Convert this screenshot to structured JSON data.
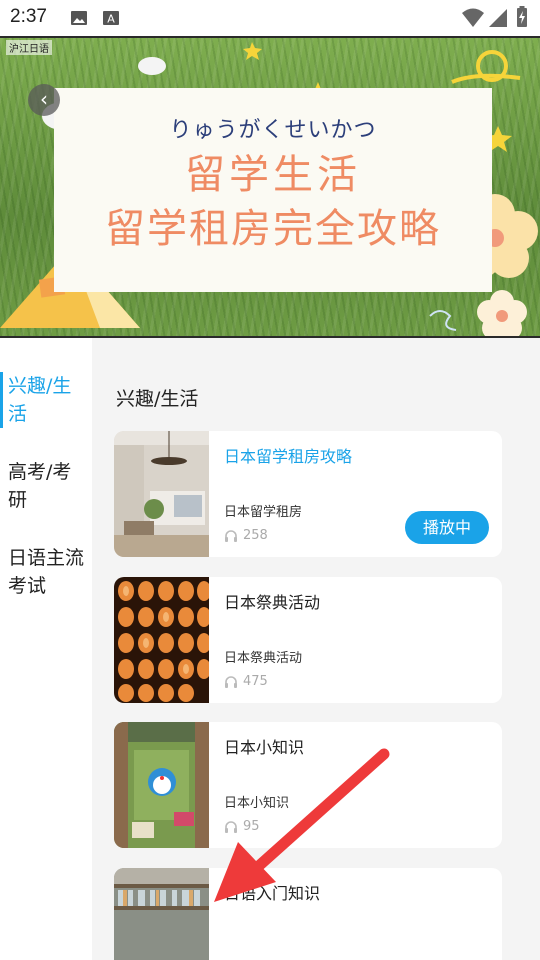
{
  "status_bar": {
    "time": "2:37",
    "icons": [
      "image-icon",
      "font-download-icon",
      "wifi-icon",
      "signal-icon",
      "battery-charging-icon"
    ]
  },
  "banner": {
    "logo_text": "沪江日语",
    "kana": "りゅうがくせいかつ",
    "title_line1": "留学生活",
    "title_line2": "留学租房完全攻略",
    "accent_color": "#ef8b63"
  },
  "sidebar": {
    "items": [
      {
        "label": "兴趣/生活",
        "active": true
      },
      {
        "label": "高考/考研",
        "active": false
      },
      {
        "label": "日语主流考试",
        "active": false
      }
    ]
  },
  "main": {
    "section_title": "兴趣/生活",
    "play_label": "播放中",
    "items": [
      {
        "title": "日本留学租房攻略",
        "subtitle": "日本留学租房",
        "count": "258",
        "playing": true,
        "thumb": "room"
      },
      {
        "title": "日本祭典活动",
        "subtitle": "日本祭典活动",
        "count": "475",
        "playing": false,
        "thumb": "lanterns"
      },
      {
        "title": "日本小知识",
        "subtitle": "日本小知识",
        "count": "95",
        "playing": false,
        "thumb": "doraemon"
      },
      {
        "title": "日语入门知识",
        "subtitle": "",
        "count": "",
        "playing": false,
        "thumb": "bookshelf"
      }
    ]
  },
  "colors": {
    "accent": "#1aa3e8",
    "annotation_arrow": "#ee3a3a"
  }
}
